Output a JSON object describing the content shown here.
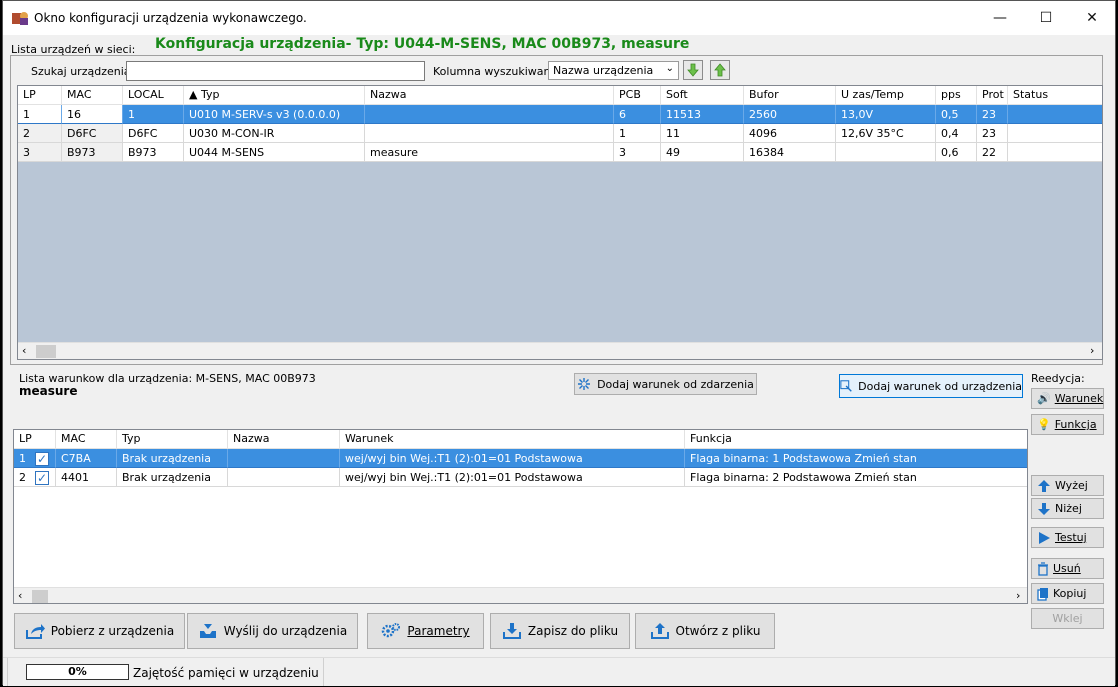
{
  "window": {
    "title": "Okno konfiguracji urządzenia wykonawczego.",
    "controls": {
      "minimize": "—",
      "maximize": "☐",
      "close": "✕"
    }
  },
  "header": {
    "list_label": "Lista urządzeń w sieci:",
    "config_title": "Konfiguracja urządzenia- Typ: U044-M-SENS, MAC 00B973, measure"
  },
  "search": {
    "label": "Szukaj urządzenia:",
    "value": "",
    "column_label": "Kolumna wyszukiwania:",
    "column_value": "Nazwa urządzenia"
  },
  "devices": {
    "columns": [
      "LP",
      "MAC",
      "LOCAL",
      "▲ Typ",
      "Nazwa",
      "PCB",
      "Soft",
      "Bufor",
      "U zas/Temp",
      "pps",
      "Prot",
      "Status"
    ],
    "rows": [
      [
        "1",
        "16",
        "1",
        "U010 M-SERV-s v3 (0.0.0.0)",
        "",
        "6",
        "11513",
        "2560",
        "13,0V",
        "0,5",
        "23",
        ""
      ],
      [
        "2",
        "D6FC",
        "D6FC",
        "U030 M-CON-IR",
        "",
        "1",
        "11",
        "4096",
        "12,6V 35°C",
        "0,4",
        "23",
        ""
      ],
      [
        "3",
        "B973",
        "B973",
        "U044 M-SENS",
        "measure",
        "3",
        "49",
        "16384",
        "",
        "0,6",
        "22",
        ""
      ]
    ]
  },
  "conditions": {
    "list_label": "Lista warunkow dla urządzenia: M-SENS, MAC 00B973",
    "device_name": "measure",
    "add_from_event": "Dodaj warunek od zdarzenia",
    "add_from_device": "Dodaj warunek od urządzenia",
    "columns": [
      "LP",
      "MAC",
      "Typ",
      "Nazwa",
      "Warunek",
      "Funkcja"
    ],
    "rows": [
      [
        "1",
        "C7BA",
        "Brak urządzenia",
        "",
        "wej/wyj bin Wej.:T1  (2):01=01  Podstawowa",
        "Flaga binarna:  1  Podstawowa Zmień stan"
      ],
      [
        "2",
        "4401",
        "Brak urządzenia",
        "",
        "wej/wyj bin Wej.:T1  (2):01=01  Podstawowa",
        "Flaga binarna:  2  Podstawowa Zmień stan"
      ]
    ]
  },
  "side": {
    "edit_label": "Reedycja:",
    "warunek": "Warunek",
    "funkcja": "Funkcja",
    "wyzej": "Wyżej",
    "nizej": "Niżej",
    "testuj": "Testuj",
    "usun": "Usuń",
    "kopiuj": "Kopiuj",
    "wklej": "Wklej"
  },
  "bottom_buttons": {
    "pobierz": "Pobierz z urządzenia",
    "wyslij": "Wyślij do urządzenia",
    "parametry": "Parametry",
    "zapisz": "Zapisz do pliku",
    "otworz": "Otwórz z pliku"
  },
  "status": {
    "memory_percent": "0%",
    "memory_label": "Zajętość pamięci w urządzeniu"
  },
  "colors": {
    "selection": "#3b8fe0",
    "title_green": "#1a8a1a",
    "accent_blue": "#1e73c8"
  }
}
